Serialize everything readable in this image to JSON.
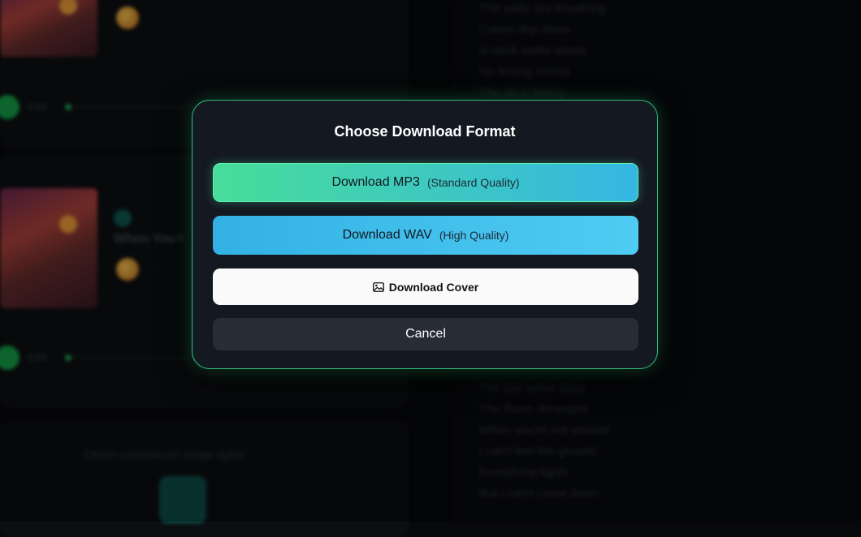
{
  "modal": {
    "title": "Choose Download Format",
    "mp3": {
      "label": "Download MP3",
      "quality": "(Standard Quality)"
    },
    "wav": {
      "label": "Download WAV",
      "quality": "(High Quality)"
    },
    "cover": {
      "label": "Download Cover",
      "icon": "image-icon"
    },
    "cancel": {
      "label": "Cancel"
    }
  },
  "background": {
    "song2_title": "When You'r",
    "time_label": "0:00",
    "rights_text": "Obtain commercial usage rights",
    "lyrics_top": [
      "The walls are breathing",
      "Colors drip down",
      "A clock melts slowly",
      "No ticking sound",
      "The air is heavy"
    ],
    "lyrics_bottom": [
      "The last some days",
      "The floors deranged",
      "When you're not around",
      "I can't feel the ground",
      "Everything lights",
      "But I can't come down"
    ]
  },
  "colors": {
    "modal_border": "#2fbf7c",
    "mp3_gradient_start": "#47dd99",
    "mp3_gradient_end": "#35b6e4",
    "wav_gradient_start": "#33b1e4",
    "wav_gradient_end": "#4fccf3",
    "cancel_bg": "#272c37"
  }
}
